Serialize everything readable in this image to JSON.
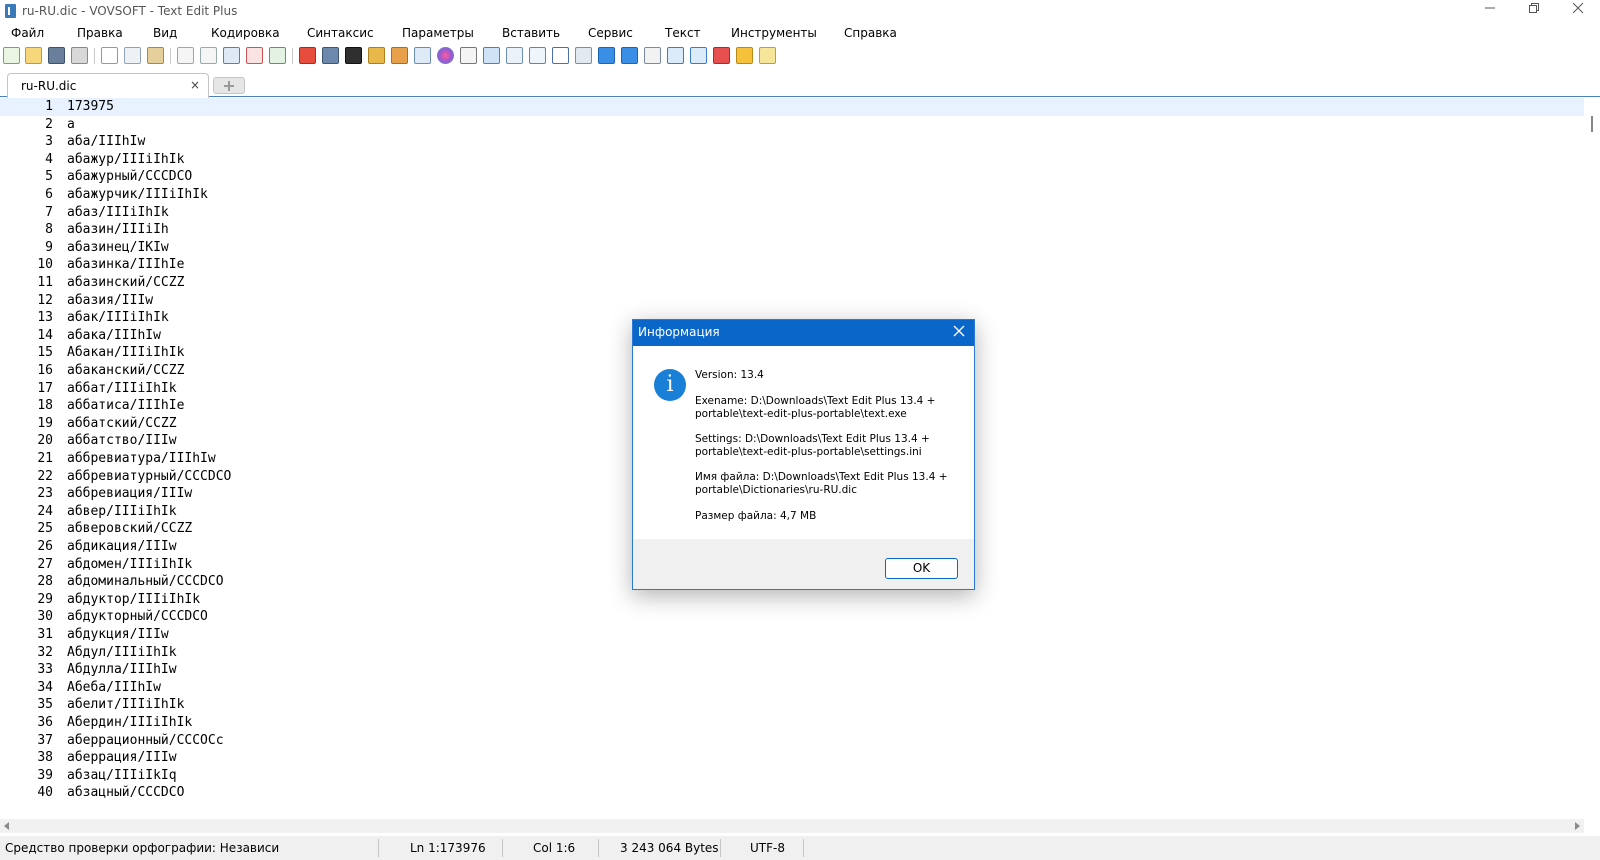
{
  "window": {
    "title": "ru-RU.dic - VOVSOFT - Text Edit Plus",
    "minimize_icon": "minimize-icon",
    "maximize_icon": "restore-icon",
    "close_icon": "close-icon"
  },
  "menu": [
    "Файл",
    "Правка",
    "Вид",
    "Кодировка",
    "Синтаксис",
    "Параметры",
    "Вставить",
    "Сервис",
    "Текст",
    "Инструменты",
    "Справка"
  ],
  "toolbar_icons": [
    "new-file-icon",
    "open-file-icon",
    "save-icon",
    "print-icon",
    "cut-icon",
    "copy-icon",
    "paste-icon",
    "undo-icon",
    "redo-icon",
    "find-icon",
    "replace-icon",
    "goto-icon",
    "pdf-icon",
    "monitor-icon",
    "font-icon",
    "lock-icon",
    "unlock-icon",
    "export-icon",
    "color-picker-icon",
    "pen-icon",
    "filter-icon",
    "table-icon",
    "mail-icon",
    "list-icon",
    "keyboard-icon",
    "arrow-right-icon",
    "arrow-down-icon",
    "window-icon",
    "sort-asc-icon",
    "sort-desc-icon",
    "calendar-icon",
    "warning-icon",
    "note-icon"
  ],
  "tabs": [
    {
      "label": "ru-RU.dic",
      "close": "×"
    }
  ],
  "editor": {
    "current_line": 1,
    "lines": [
      "173975",
      "а",
      "аба/IIIhIw",
      "абажур/IIIiIhIk",
      "абажурный/CCCDCO",
      "абажурчик/IIIiIhIk",
      "абаз/IIIiIhIk",
      "абазин/IIIiIh",
      "абазинец/IKIw",
      "абазинка/IIIhIe",
      "абазинский/CCZZ",
      "абазия/IIIw",
      "абак/IIIiIhIk",
      "абака/IIIhIw",
      "Абакан/IIIiIhIk",
      "абаканский/CCZZ",
      "аббат/IIIiIhIk",
      "аббатиса/IIIhIe",
      "аббатский/CCZZ",
      "аббатство/IIIw",
      "аббревиатура/IIIhIw",
      "аббревиатурный/CCCDCO",
      "аббревиация/IIIw",
      "абвер/IIIiIhIk",
      "абверовский/CCZZ",
      "абдикация/IIIw",
      "абдомен/IIIiIhIk",
      "абдоминальный/CCCDCO",
      "абдуктор/IIIiIhIk",
      "абдукторный/CCCDCO",
      "абдукция/IIIw",
      "Абдул/IIIiIhIk",
      "Абдулла/IIIhIw",
      "Абеба/IIIhIw",
      "абелит/IIIiIhIk",
      "Абердин/IIIiIhIk",
      "аберрационный/CCCOCc",
      "аберрация/IIIw",
      "абзац/IIIiIkIq",
      "абзацный/CCCDCO"
    ]
  },
  "status": {
    "spell": "Средство проверки орфографии: Независимо от ...",
    "position": "Ln 1:173976",
    "column": "Col 1:6",
    "bytes": "3 243 064 Bytes",
    "encoding": "UTF-8"
  },
  "dialog": {
    "title": "Информация",
    "icon": "info-icon",
    "version": "Version: 13.4",
    "exename": "Exename: D:\\Downloads\\Text Edit Plus 13.4 + portable\\text-edit-plus-portable\\text.exe",
    "settings": "Settings: D:\\Downloads\\Text Edit Plus 13.4 + portable\\text-edit-plus-portable\\settings.ini",
    "filename": "Имя файла: D:\\Downloads\\Text Edit Plus 13.4 + portable\\Dictionaries\\ru-RU.dic",
    "filesize": "Размер файла: 4,7 MB",
    "ok_label": "OK"
  },
  "colors": {
    "accent": "#0a66c8",
    "current_line": "#e8f2fe",
    "statusbar": "#f0f0f0"
  }
}
